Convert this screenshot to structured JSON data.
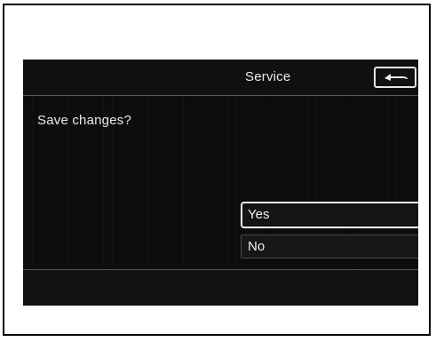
{
  "screen": {
    "title": "Service",
    "prompt": "Save changes?",
    "options": [
      {
        "label": "Yes",
        "selected": true
      },
      {
        "label": "No",
        "selected": false
      }
    ],
    "back_icon": "back-arrow-icon"
  },
  "colors": {
    "screen_background": "#0c0c0c",
    "text": "#eaeaea",
    "selection_outline": "#f0f0f0",
    "divider": "#555555"
  }
}
